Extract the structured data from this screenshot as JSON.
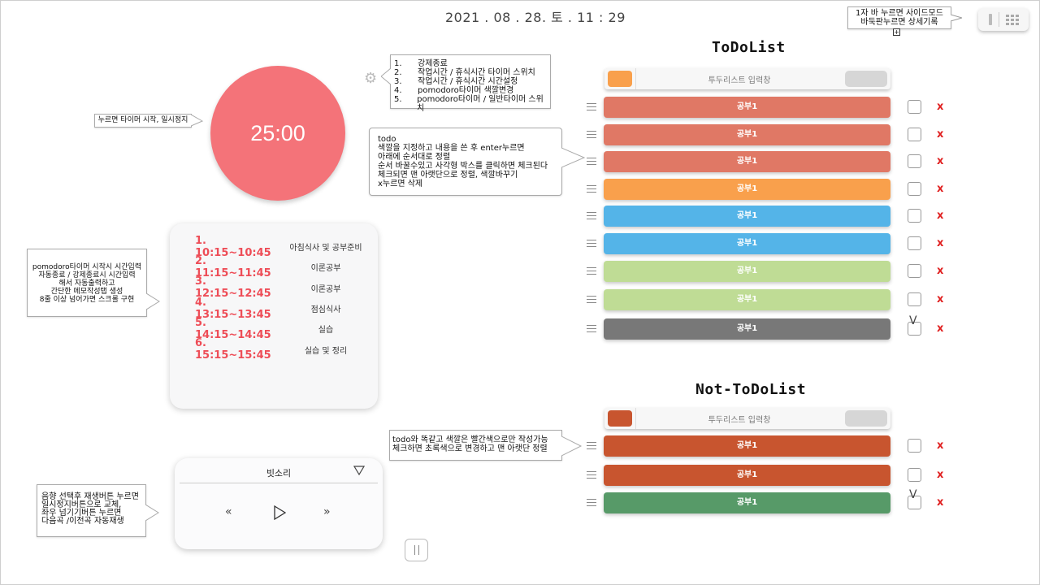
{
  "datetime": "2021 . 08 . 28. 토  . 11 : 29",
  "top_note": {
    "line1": "1자 바 누르면 사이드모드",
    "line2": "바둑판누르면 상세기록"
  },
  "timer": {
    "display": "25:00",
    "color": "#f47379"
  },
  "settings_note": [
    {
      "num": "1.",
      "text": "강제종료"
    },
    {
      "num": "2.",
      "text": "작업시간 / 휴식시간 타이머 스위치"
    },
    {
      "num": "3.",
      "text": "작업시간 / 휴식시간 시간설정"
    },
    {
      "num": "4.",
      "text": "pomodoro타이머 색깔변경"
    },
    {
      "num": "5.",
      "text": "pomodoro타이머 / 일반타이머 스위치"
    }
  ],
  "timer_note": "누르면 타이머 시작, 일시정지",
  "todo_note": [
    "todo",
    "색깔을 지정하고 내용을 쓴 후 enter누르면",
    "아래에 순서대로 정렬",
    "순서 바꿀수있고 사각형 박스를 클릭하면 체크된다",
    "체크되면 맨 아랫단으로 정렬, 색깔바꾸기",
    "x누르면 삭제"
  ],
  "schedule_note": [
    "pomodoro타이머 시작시 시간입력",
    "자동종료 / 강제종료시 시간입력",
    "해서 자동출력하고",
    "간단한 메모작성탭 생성",
    "8줄 이상 넘어가면 스크롤 구현"
  ],
  "notdo_note": [
    "todo와 똑같고 색깔은 빨간색으로만 작성가능",
    "체크하면 초록색으로 변경하고 맨 아랫단 정렬"
  ],
  "music_note": [
    "음향 선택후 재생버튼 누르면",
    "일시정지버튼으로 교체,",
    "좌우 넘기기버튼 누르면",
    "다음곡 /이전곡 자동재생"
  ],
  "schedule": [
    {
      "time": "1. 10:15~10:45",
      "desc": "아침식사 및 공부준비"
    },
    {
      "time": "2. 11:15~11:45",
      "desc": "이론공부"
    },
    {
      "time": "3. 12:15~12:45",
      "desc": "이론공부"
    },
    {
      "time": "4. 13:15~13:45",
      "desc": "점심식사"
    },
    {
      "time": "5. 14:15~14:45",
      "desc": "실습"
    },
    {
      "time": "6. 15:15~15:45",
      "desc": "실습 및 정리"
    }
  ],
  "player": {
    "track": "빗소리",
    "prev": "«",
    "next": "»"
  },
  "todo": {
    "title": "ToDoList",
    "input_placeholder": "투두리스트 입력창",
    "input_color": "#f9a04c",
    "items": [
      {
        "label": "공부1",
        "color": "#e07865",
        "checked": false
      },
      {
        "label": "공부1",
        "color": "#e07865",
        "checked": false
      },
      {
        "label": "공부1",
        "color": "#e07865",
        "checked": false
      },
      {
        "label": "공부1",
        "color": "#f9a04c",
        "checked": false
      },
      {
        "label": "공부1",
        "color": "#54b4e8",
        "checked": false
      },
      {
        "label": "공부1",
        "color": "#54b4e8",
        "checked": false
      },
      {
        "label": "공부1",
        "color": "#bfdc95",
        "checked": false
      },
      {
        "label": "공부1",
        "color": "#bfdc95",
        "checked": false
      },
      {
        "label": "공부1",
        "color": "#787878",
        "checked": true
      }
    ]
  },
  "notdo": {
    "title": "Not-ToDoList",
    "input_placeholder": "투두리스트 입력창",
    "input_color": "#c8552f",
    "items": [
      {
        "label": "공부1",
        "color": "#c8552f",
        "checked": false
      },
      {
        "label": "공부1",
        "color": "#c8552f",
        "checked": false
      },
      {
        "label": "공부1",
        "color": "#579a68",
        "checked": true
      }
    ]
  },
  "check_mark": "V",
  "delete_mark": "x"
}
